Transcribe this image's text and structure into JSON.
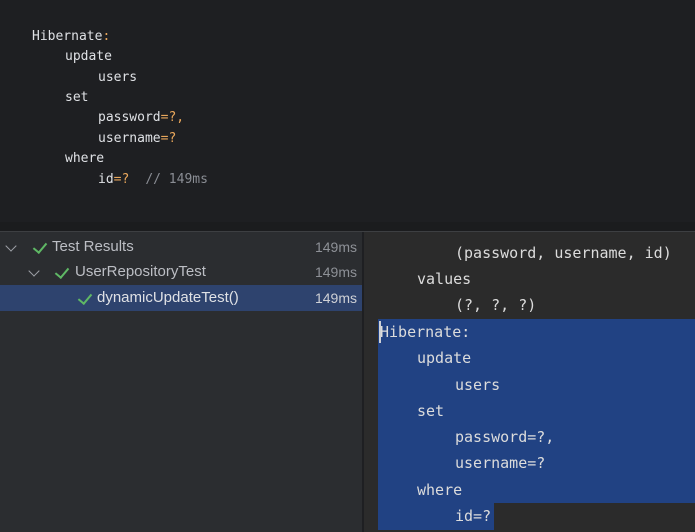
{
  "editor": {
    "hibernate_label": "Hibernate",
    "colon": ":",
    "update_keyword": "update",
    "table_name": "users",
    "set_keyword": "set",
    "password_col": "password",
    "username_col": "username",
    "where_keyword": "where",
    "id_col": "id",
    "eq_param": "=?",
    "eq_param_comma": "=?,",
    "timing_comment": "// 149ms"
  },
  "test_results": {
    "items": [
      {
        "label": "Test Results",
        "time": "149ms"
      },
      {
        "label": "UserRepositoryTest",
        "time": "149ms"
      },
      {
        "label": "dynamicUpdateTest()",
        "time": "149ms"
      }
    ]
  },
  "console": {
    "lines": [
      "(password, username, id)",
      "values",
      "(?, ?, ?)",
      "Hibernate:",
      "update",
      "users",
      "set",
      "password=?,",
      "username=?",
      "where",
      "id=?"
    ],
    "selection_color": "#214283"
  },
  "colors": {
    "editor_bg": "#1e1f22",
    "panel_bg": "#2b2d30",
    "selected_row": "#2e436e",
    "pass_check": "#5fb865",
    "operator": "#e8a65b"
  }
}
